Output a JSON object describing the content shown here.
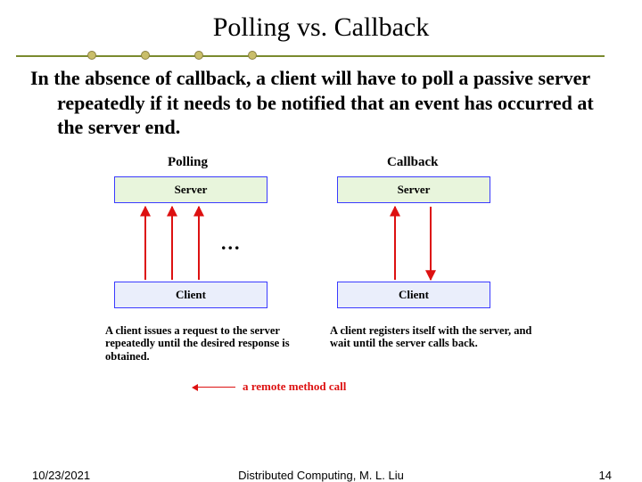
{
  "title": "Polling vs. Callback",
  "body": "In the absence of callback, a client will have to poll a passive server repeatedly if it needs to be notified that an event has occurred at the server end.",
  "figure": {
    "left": {
      "title": "Polling",
      "server_label": "Server",
      "client_label": "Client",
      "caption": "A client issues a request to the server repeatedly until the desired response is obtained.",
      "ellipsis": "..."
    },
    "right": {
      "title": "Callback",
      "server_label": "Server",
      "client_label": "Client",
      "caption": "A client registers itself with the server, and wait until the server calls back."
    },
    "legend": "a remote method call"
  },
  "colors": {
    "arrow_red": "#d11",
    "box_border": "#3a3aff",
    "server_fill": "#e8f5dc",
    "client_fill": "#eaeefb",
    "rule": "#7a8a2e"
  },
  "footer": {
    "date": "10/23/2021",
    "center": "Distributed Computing, M. L. Liu",
    "page": "14"
  }
}
